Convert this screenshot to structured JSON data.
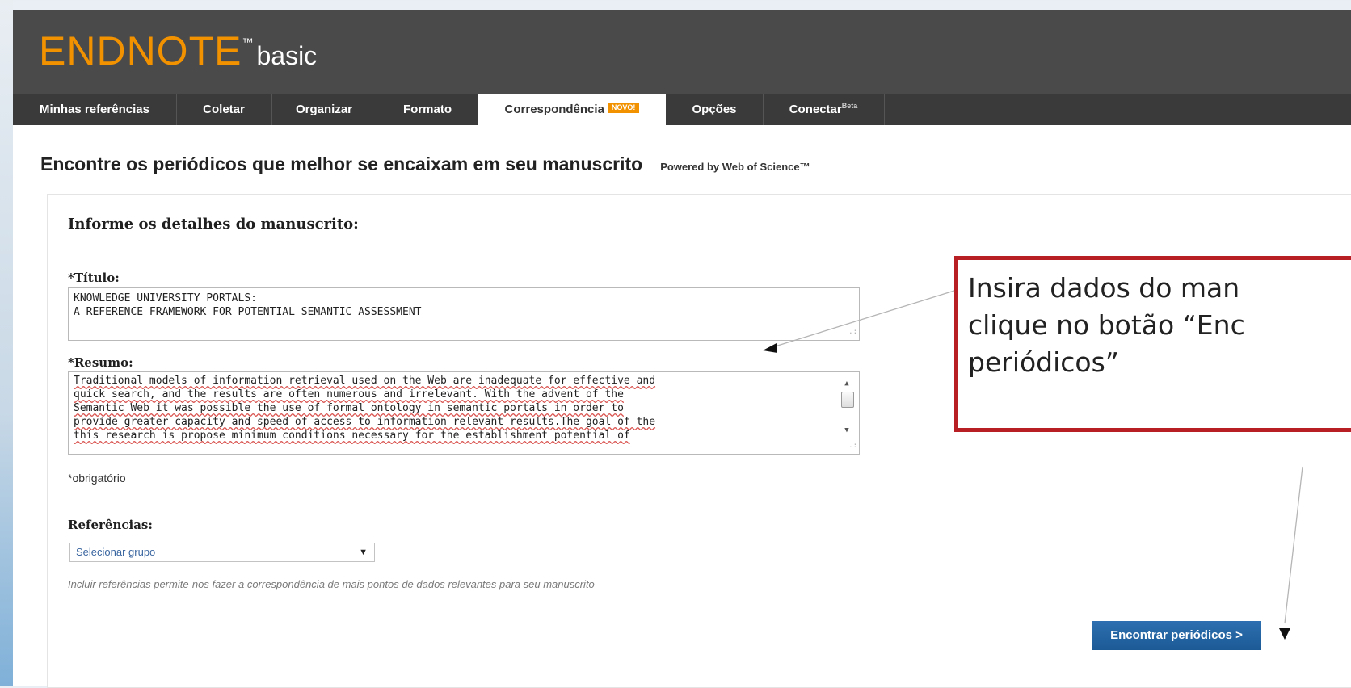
{
  "logo": {
    "brand": "ENDNOTE",
    "tm": "™",
    "edition": "basic"
  },
  "nav": {
    "items": [
      {
        "label": "Minhas referências"
      },
      {
        "label": "Coletar"
      },
      {
        "label": "Organizar"
      },
      {
        "label": "Formato"
      },
      {
        "label": "Correspondência",
        "badge": "NOVO!"
      },
      {
        "label": "Opções"
      },
      {
        "label": "Conectar",
        "sup": "Beta"
      }
    ],
    "active": "Correspondência"
  },
  "page": {
    "heading": "Encontre os periódicos que melhor se encaixam em seu manuscrito",
    "powered_by": "Powered by Web of Science™"
  },
  "form": {
    "title": "Informe os detalhes do manuscrito:",
    "titulo_label": "*Título:",
    "titulo_value": [
      "KNOWLEDGE UNIVERSITY PORTALS:",
      "A REFERENCE FRAMEWORK FOR POTENTIAL SEMANTIC ASSESSMENT"
    ],
    "resumo_label": "*Resumo:",
    "resumo_value": [
      "Traditional models of information retrieval used on the Web are inadequate for effective and",
      "quick search, and the results are often numerous and irrelevant. With the advent of the",
      "Semantic Web it was possible the use of formal ontology in semantic portals in order to",
      "provide greater capacity and speed of access to information relevant results.The goal of the",
      "this research is propose minimum conditions necessary for the establishment potential of"
    ],
    "required_note": "*obrigatório",
    "referencias_label": "Referências:",
    "group_select": "Selecionar grupo",
    "help_text": "Incluir referências permite-nos fazer a correspondência de mais pontos de dados relevantes para seu manuscrito",
    "submit_label": "Encontrar periódicos >"
  },
  "callout": {
    "lines": [
      "Insira dados do man",
      "clique no botão “Enc",
      "periódicos”"
    ],
    "border_color": "#b81f24"
  },
  "colors": {
    "header_bg": "#4a4a4a",
    "nav_bg": "#3a3a3a",
    "logo": "#f39200",
    "button": "#1f5f9e"
  }
}
